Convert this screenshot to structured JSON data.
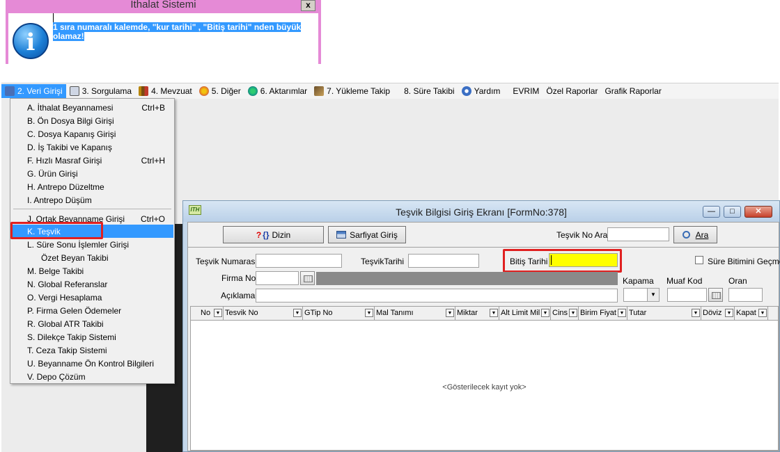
{
  "message_box": {
    "title": "İthalat Sistemi",
    "close": "x",
    "text": "1 sıra numaralı kalemde, \"kur tarihi\" , \"Bitiş tarihi\" nden büyük olamaz!"
  },
  "menubar": {
    "items": [
      {
        "label": "2. Veri Girişi",
        "icon": "edit-icon"
      },
      {
        "label": "3. Sorgulama",
        "icon": "search-doc-icon"
      },
      {
        "label": "4. Mevzuat",
        "icon": "books-icon"
      },
      {
        "label": "5. Diğer",
        "icon": "misc-icon"
      },
      {
        "label": "6. Aktarımlar",
        "icon": "transfer-icon"
      },
      {
        "label": "7. Yükleme Takip",
        "icon": "truck-icon"
      },
      {
        "label": "8. Süre Takibi",
        "icon": ""
      },
      {
        "label": "Yardım",
        "icon": "help-icon"
      },
      {
        "label": "EVRIM",
        "icon": ""
      },
      {
        "label": "Özel Raporlar",
        "icon": ""
      },
      {
        "label": "Grafik Raporlar",
        "icon": ""
      }
    ]
  },
  "dropdown": {
    "items": [
      {
        "label": "A.  İthalat Beyannamesi",
        "shortcut": "Ctrl+B"
      },
      {
        "label": "B.  Ön Dosya Bilgi Girişi",
        "shortcut": ""
      },
      {
        "label": "C.  Dosya Kapanış Girişi",
        "shortcut": ""
      },
      {
        "label": "D.  İş Takibi ve Kapanış",
        "shortcut": ""
      },
      {
        "label": "F.  Hızlı Masraf Girişi",
        "shortcut": "Ctrl+H"
      },
      {
        "label": "G.  Ürün Girişi",
        "shortcut": ""
      },
      {
        "label": "H.  Antrepo Düzeltme",
        "shortcut": ""
      },
      {
        "label": "I.   Antrepo Düşüm",
        "shortcut": ""
      },
      {
        "label": "J.  Ortak Beyanname Girişi",
        "shortcut": "Ctrl+O"
      },
      {
        "label": "K.  Teşvik",
        "shortcut": ""
      },
      {
        "label": "L.  Süre Sonu İşlemler Girişi",
        "shortcut": ""
      },
      {
        "label": "      Özet Beyan Takibi",
        "shortcut": ""
      },
      {
        "label": "M.  Belge Takibi",
        "shortcut": ""
      },
      {
        "label": "N.  Global Referanslar",
        "shortcut": ""
      },
      {
        "label": "O. Vergi Hesaplama",
        "shortcut": ""
      },
      {
        "label": "P. Firma Gelen Ödemeler",
        "shortcut": ""
      },
      {
        "label": "R. Global ATR Takibi",
        "shortcut": ""
      },
      {
        "label": "S. Dilekçe Takip Sistemi",
        "shortcut": ""
      },
      {
        "label": "T. Ceza Takip Sistemi",
        "shortcut": ""
      },
      {
        "label": "U. Beyanname Ön Kontrol Bilgileri",
        "shortcut": ""
      },
      {
        "label": "V. Depo Çözüm",
        "shortcut": ""
      }
    ]
  },
  "window": {
    "title": "Teşvik Bilgisi Giriş Ekranı [FormNo:378]",
    "buttons": {
      "dizin": "Dizin",
      "sarfiyat": "Sarfiyat Giriş",
      "ara": "Ara"
    },
    "labels": {
      "tesvik_no_ara": "Teşvik No Ara",
      "tesvik_numarasi": "Teşvik Numarası",
      "tesvik_tarihi": "TeşvikTarihi",
      "bitis_tarihi": "Bitiş Tarihi",
      "sure_bitimi": "Süre Bitimini Geçme",
      "firma_no": "Firma No",
      "kapama": "Kapama",
      "muaf_kod": "Muaf Kod",
      "oran": "Oran",
      "aciklama": "Açıklama"
    },
    "grid": {
      "columns": [
        "No",
        "Tesvik No",
        "GTip No",
        "Mal Tanımı",
        "Miktar",
        "Alt Limit Mil",
        "Cins",
        "Birim Fiyat",
        "Tutar",
        "Döviz",
        "Kapat"
      ],
      "empty_text": "<Gösterilecek kayıt yok>"
    }
  },
  "colors": {
    "highlight": "#3399ff",
    "required_field": "#ffff00",
    "annotation": "#e02020"
  }
}
